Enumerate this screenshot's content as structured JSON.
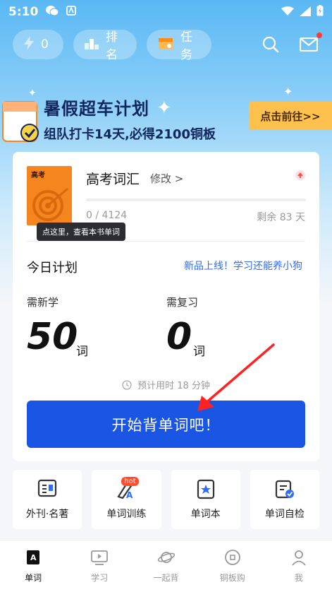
{
  "status_bar": {
    "time": "5:10"
  },
  "toolbar": {
    "energy_count": "0",
    "rank_label": "排名",
    "task_label": "任务"
  },
  "banner": {
    "title": "暑假超车计划",
    "subtitle": "组队打卡14天,必得2100铜板",
    "cta": "点击前往>>"
  },
  "book": {
    "cover_title": "高考",
    "name": "高考词汇",
    "edit_label": "修改 >",
    "tooltip": "点这里，查看本书单词",
    "progress_text": "0 / 4124",
    "progress_fraction": 0,
    "remaining": "剩余 83 天"
  },
  "plan": {
    "title": "今日计划",
    "promo_link": "新品上线！学习还能养小狗",
    "new_label": "需新学",
    "new_count": "50",
    "review_label": "需复习",
    "review_count": "0",
    "unit": "词",
    "estimate": "预计用时 18 分钟",
    "start_button": "开始背单词吧！"
  },
  "tiles": [
    {
      "label": "外刊·名著",
      "icon": "magazine-icon"
    },
    {
      "label": "单词训练",
      "icon": "word-training-icon",
      "badge": "hot"
    },
    {
      "label": "单词本",
      "icon": "wordbook-icon"
    },
    {
      "label": "单词自检",
      "icon": "self-check-icon"
    }
  ],
  "tabbar": [
    {
      "label": "单词",
      "active": true
    },
    {
      "label": "学习"
    },
    {
      "label": "一起背"
    },
    {
      "label": "铜板购"
    },
    {
      "label": "我"
    }
  ],
  "colors": {
    "primary": "#1a55e3",
    "banner_button": "#ffc14d",
    "book_cover": "#f5851f"
  }
}
